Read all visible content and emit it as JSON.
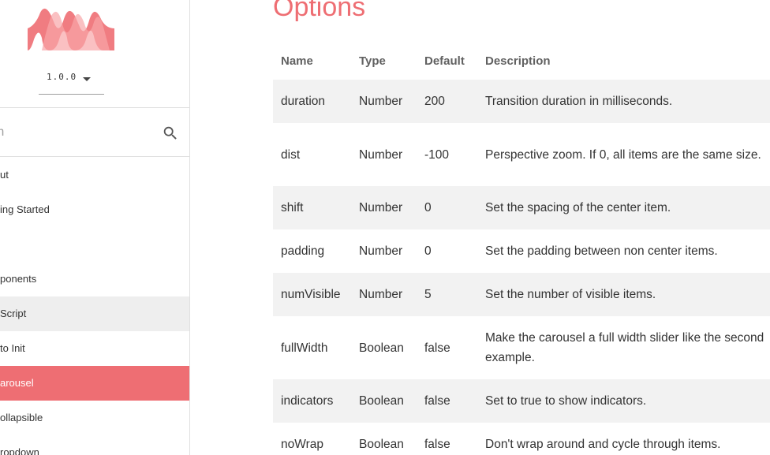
{
  "sidebar": {
    "version": "1.0.0",
    "search_placeholder": "Search",
    "search_visible_text": "rch",
    "items": [
      {
        "label": "ut"
      },
      {
        "label": "ing Started"
      },
      {
        "label": "ponents"
      },
      {
        "label": "Script"
      },
      {
        "label": "to Init"
      },
      {
        "label": "arousel"
      },
      {
        "label": "ollapsible"
      },
      {
        "label": "ropdown"
      }
    ],
    "active_color": "#ee6e73"
  },
  "main": {
    "title": "Options",
    "headers": [
      "Name",
      "Type",
      "Default",
      "Description"
    ],
    "rows": [
      {
        "name": "duration",
        "type": "Number",
        "default": "200",
        "description": "Transition duration in milliseconds."
      },
      {
        "name": "dist",
        "type": "Number",
        "default": "-100",
        "description": "Perspective zoom. If 0, all items are the same size."
      },
      {
        "name": "shift",
        "type": "Number",
        "default": "0",
        "description": "Set the spacing of the center item."
      },
      {
        "name": "padding",
        "type": "Number",
        "default": "0",
        "description": "Set the padding between non center items."
      },
      {
        "name": "numVisible",
        "type": "Number",
        "default": "5",
        "description": "Set the number of visible items."
      },
      {
        "name": "fullWidth",
        "type": "Boolean",
        "default": "false",
        "description": "Make the carousel a full width slider like the second example."
      },
      {
        "name": "indicators",
        "type": "Boolean",
        "default": "false",
        "description": "Set to true to show indicators."
      },
      {
        "name": "noWrap",
        "type": "Boolean",
        "default": "false",
        "description": "Don't wrap around and cycle through items."
      }
    ]
  }
}
